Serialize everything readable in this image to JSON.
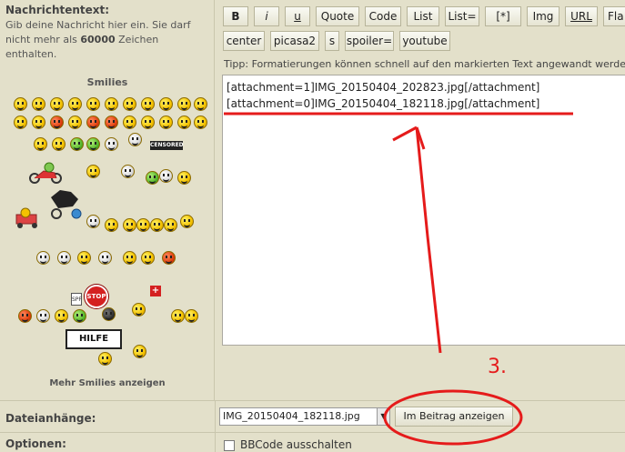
{
  "left": {
    "label": "Nachrichtentext:",
    "help_pre": "Gib deine Nachricht hier ein. Sie darf nicht mehr als ",
    "help_num": "60000",
    "help_post": " Zeichen enthalten.",
    "smilies_title": "Smilies",
    "more_smilies": "Mehr Smilies anzeigen",
    "stop_sign": "STOP",
    "hilfe_sign": "HILFE",
    "censored_sign": "CENSORED",
    "spf_sign": "SPF"
  },
  "toolbar": {
    "row1": [
      "B",
      "i",
      "u",
      "Quote",
      "Code",
      "List",
      "List=",
      "[*]",
      "Img",
      "URL",
      "Fla"
    ],
    "row2": [
      "center",
      "picasa2",
      "s",
      "spoiler=",
      "youtube"
    ]
  },
  "tip": "Tipp: Formatierungen können schnell auf den markierten Text angewandt werden.",
  "editor": {
    "lines": [
      "[attachment=1]IMG_20150404_202823.jpg[/attachment]",
      "[attachment=0]IMG_20150404_182118.jpg[/attachment]"
    ]
  },
  "attachments": {
    "label": "Dateianhänge:",
    "selected_file": "IMG_20150404_182118.jpg",
    "insert_button": "Im Beitrag anzeigen"
  },
  "options": {
    "label": "Optionen:",
    "bbcode_off": "BBCode ausschalten"
  },
  "annotation": {
    "step": "3.",
    "color": "#e51b1b"
  }
}
